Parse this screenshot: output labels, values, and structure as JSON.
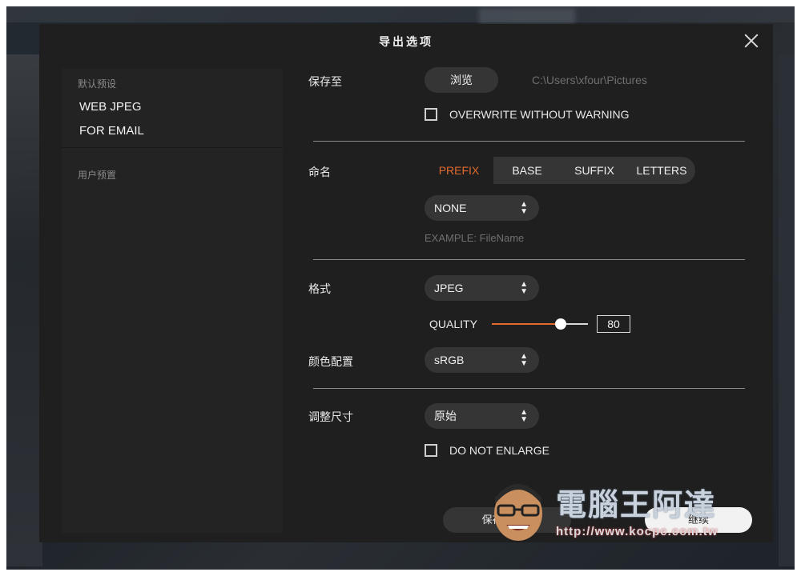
{
  "dialog": {
    "title": "导出选项",
    "close_icon": "close-icon"
  },
  "presets": {
    "default_header": "默认预设",
    "items": [
      "WEB JPEG",
      "FOR EMAIL"
    ],
    "user_header": "用户预置"
  },
  "save": {
    "label": "保存至",
    "browse_label": "浏览",
    "path": "C:\\Users\\xfour\\Pictures",
    "overwrite_label": "OVERWRITE WITHOUT WARNING",
    "overwrite_checked": false
  },
  "naming": {
    "label": "命名",
    "tabs": [
      "PREFIX",
      "BASE",
      "SUFFIX",
      "LETTERS"
    ],
    "active_tab": "PREFIX",
    "select_value": "NONE",
    "example": "EXAMPLE: FileName"
  },
  "format": {
    "label": "格式",
    "select_value": "JPEG",
    "quality_label": "QUALITY",
    "quality": 80,
    "quality_value": "80"
  },
  "color": {
    "label": "颜色配置",
    "select_value": "sRGB"
  },
  "resize": {
    "label": "调整尺寸",
    "select_value": "原始",
    "no_enlarge_label": "DO NOT ENLARGE",
    "no_enlarge_checked": false
  },
  "footer": {
    "save_settings_label": "保存设置...",
    "continue_label": "继续"
  },
  "watermark": {
    "text": "電腦王阿達",
    "url": "http://www.kocpc.com.tw"
  },
  "colors": {
    "accent": "#e36a2f",
    "dialog_bg": "#1f1f1f",
    "control_bg": "#353535"
  }
}
